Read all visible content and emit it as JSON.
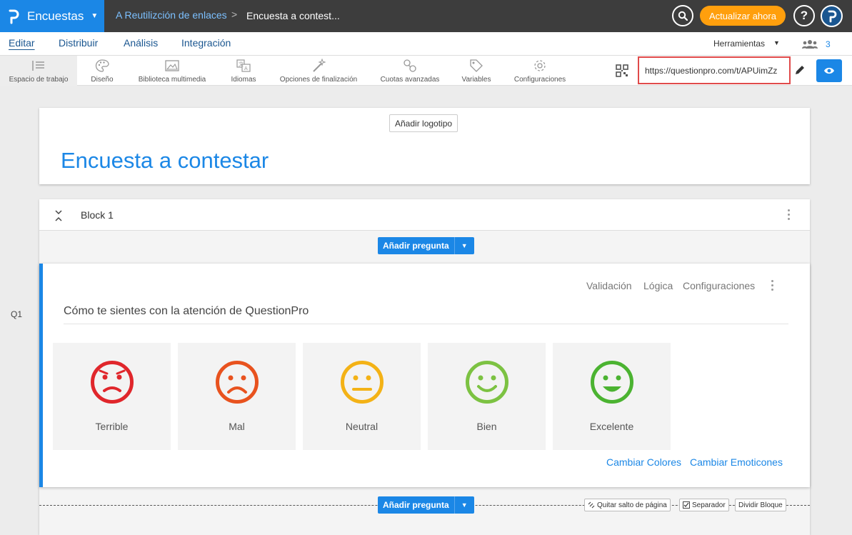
{
  "topbar": {
    "app_name": "Encuestas",
    "breadcrumb_prev": "A Reutilizción de enlaces",
    "breadcrumb_sep": ">",
    "breadcrumb_current": "Encuesta a contest...",
    "upgrade_label": "Actualizar ahora",
    "help_label": "?"
  },
  "nav": {
    "tabs": [
      "Editar",
      "Distribuir",
      "Análisis",
      "Integración"
    ],
    "tools_label": "Herramientas",
    "collaborators_count": "3"
  },
  "toolbar": {
    "items": [
      {
        "label": "Espacio de trabajo",
        "icon": "workspace-icon"
      },
      {
        "label": "Diseño",
        "icon": "palette-icon"
      },
      {
        "label": "Biblioteca multimedia",
        "icon": "image-icon"
      },
      {
        "label": "Idiomas",
        "icon": "translate-icon"
      },
      {
        "label": "Opciones de finalización",
        "icon": "magic-wand-icon"
      },
      {
        "label": "Cuotas avanzadas",
        "icon": "quota-icon"
      },
      {
        "label": "Variables",
        "icon": "tag-icon"
      },
      {
        "label": "Configuraciones",
        "icon": "gear-icon"
      }
    ],
    "survey_url": "https://questionpro.com/t/APUimZz"
  },
  "header": {
    "add_logo_label": "Añadir logotipo",
    "survey_title": "Encuesta a contestar"
  },
  "block": {
    "title": "Block 1",
    "add_question_label": "Añadir pregunta"
  },
  "question": {
    "number": "Q1",
    "actions": [
      "Validación",
      "Lógica",
      "Configuraciones"
    ],
    "text": "Cómo te sientes con la atención de QuestionPro",
    "options": [
      {
        "label": "Terrible",
        "color": "#e0262b"
      },
      {
        "label": "Mal",
        "color": "#e8521e"
      },
      {
        "label": "Neutral",
        "color": "#f3b216"
      },
      {
        "label": "Bien",
        "color": "#7cc242"
      },
      {
        "label": "Excelente",
        "color": "#4bb331"
      }
    ],
    "change_colors_label": "Cambiar Colores",
    "change_emoticons_label": "Cambiar Emoticones"
  },
  "page_break": {
    "add_question_label": "Añadir pregunta",
    "remove_break_label": "Quitar salto de página",
    "separator_label": "Separador",
    "split_block_label": "Dividir Bloque"
  },
  "colors": {
    "brand_blue": "#1b87e6",
    "topbar": "#3d3d3d",
    "upgrade_orange": "#ff9f0d",
    "highlight_red": "#e04a4a"
  }
}
